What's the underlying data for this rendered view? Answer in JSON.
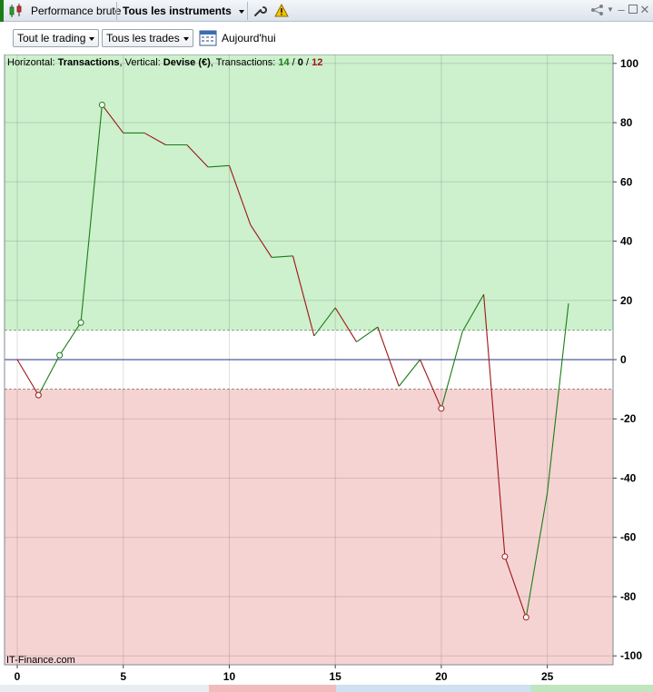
{
  "window": {
    "tab_label": "Performance brute",
    "instrument_selector": "Tous les instruments"
  },
  "toolbar": {
    "trading_filter": "Tout le trading",
    "trades_filter": "Tous les trades",
    "today_label": "Aujourd'hui"
  },
  "chart_info": {
    "horizontal_label": "Horizontal: ",
    "horizontal_value": "Transactions",
    "vertical_label": ", Vertical: ",
    "vertical_value": "Devise (€)",
    "transactions_label": ", Transactions: ",
    "winners": "14",
    "sep1": " / ",
    "neutral": "0",
    "sep2": " / ",
    "losers": "12"
  },
  "watermark": "IT-Finance.com",
  "colors": {
    "positive_zone": "#cdf0cd",
    "negative_zone": "#f5d3d3",
    "up_segment": "#1b7d16",
    "down_segment": "#a01515",
    "zero_line": "#2a2f8a"
  },
  "chart_data": {
    "type": "line",
    "title": "",
    "xlabel": "",
    "ylabel": "",
    "x": [
      0,
      1,
      2,
      3,
      4,
      5,
      6,
      7,
      8,
      9,
      10,
      11,
      12,
      13,
      14,
      15,
      16,
      17,
      18,
      19,
      20,
      21,
      22,
      23,
      24,
      25,
      26
    ],
    "y": [
      0,
      -12,
      1.5,
      12.5,
      86,
      76.5,
      76.5,
      72.5,
      72.5,
      65,
      65.5,
      45.5,
      34.5,
      35,
      8,
      17.5,
      6,
      11,
      -9,
      0,
      -16.5,
      9.5,
      22,
      -66.5,
      -87,
      -45,
      19
    ],
    "markers_x": [
      1,
      2,
      3,
      4,
      20,
      23,
      24
    ],
    "xlim": [
      -0.6,
      28.1
    ],
    "ylim": [
      -103,
      103
    ],
    "x_ticks": [
      0,
      5,
      10,
      15,
      20,
      25
    ],
    "y_ticks": [
      100,
      80,
      60,
      40,
      20,
      0,
      -20,
      -40,
      -60,
      -80,
      -100
    ],
    "upper_threshold": 10,
    "lower_threshold": -10,
    "grid": true,
    "y_axis_side": "right"
  }
}
